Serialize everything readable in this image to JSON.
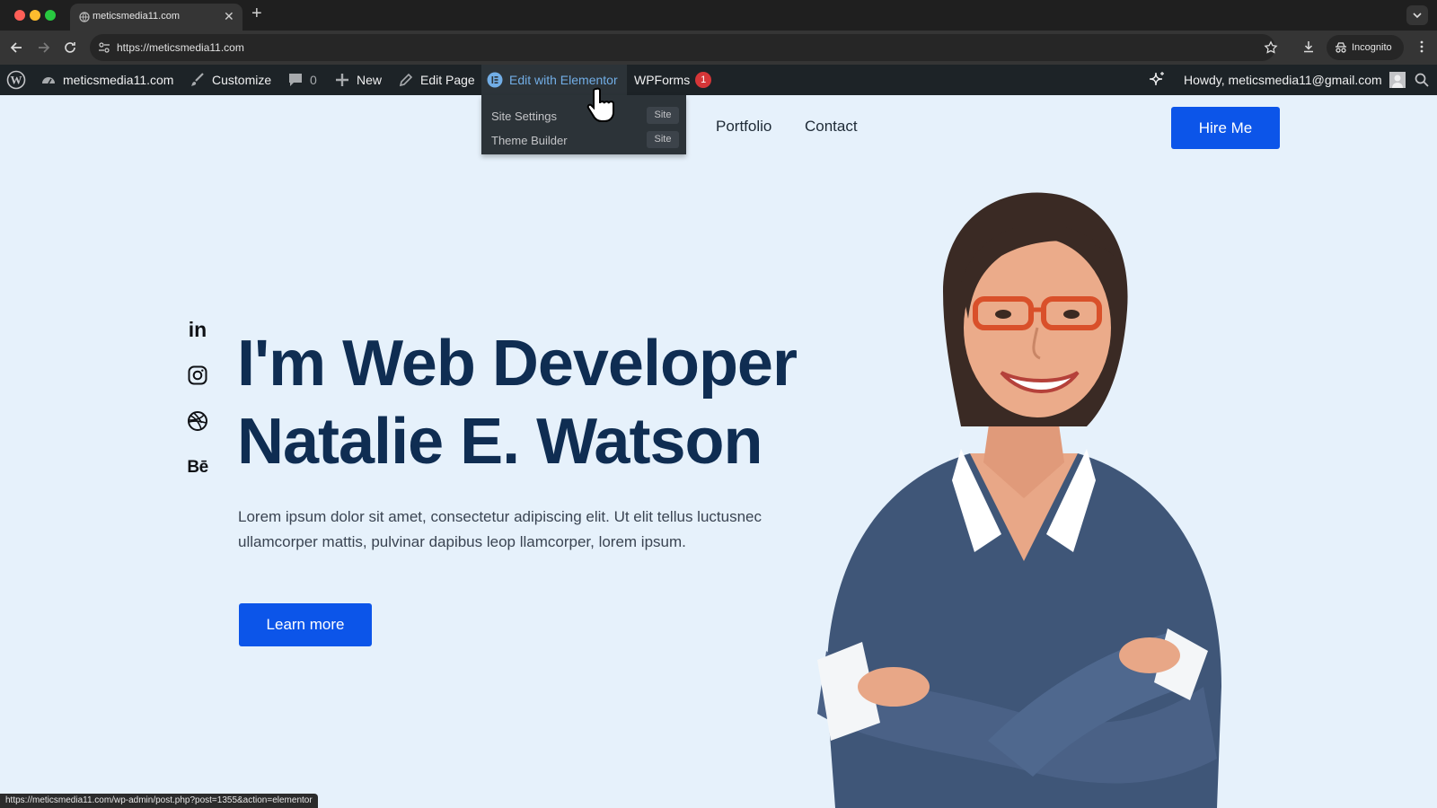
{
  "browser": {
    "tab_title": "meticsmedia11.com",
    "url": "https://meticsmedia11.com",
    "incognito_label": "Incognito",
    "status_url": "https://meticsmedia11.com/wp-admin/post.php?post=1355&action=elementor"
  },
  "adminbar": {
    "site_name": "meticsmedia11.com",
    "customize": "Customize",
    "comments_count": "0",
    "new": "New",
    "edit_page": "Edit Page",
    "edit_elementor": "Edit with Elementor",
    "wpforms": "WPForms",
    "wpforms_badge": "1",
    "howdy": "Howdy, meticsmedia11@gmail.com"
  },
  "dropdown": {
    "items": [
      {
        "label": "Site Settings",
        "tag": "Site"
      },
      {
        "label": "Theme Builder",
        "tag": "Site"
      }
    ]
  },
  "header": {
    "nav": [
      "Portfolio",
      "Contact"
    ],
    "cta": "Hire Me"
  },
  "hero": {
    "title_line1": "I'm Web Developer",
    "title_line2": "Natalie E. Watson",
    "text": "Lorem ipsum dolor sit amet, consectetur adipiscing elit. Ut elit tellus luctusnec ullamcorper mattis, pulvinar dapibus leop llamcorper, lorem ipsum.",
    "button": "Learn more",
    "social_icons": [
      "linkedin-icon",
      "instagram-icon",
      "dribbble-icon",
      "behance-icon"
    ],
    "social_glyphs": {
      "linkedin": "in",
      "behance": "Bē"
    }
  },
  "colors": {
    "accent": "#0c55e9",
    "heading": "#0f2d52",
    "page_bg": "#e6f1fb",
    "adminbar": "#1d2327"
  }
}
